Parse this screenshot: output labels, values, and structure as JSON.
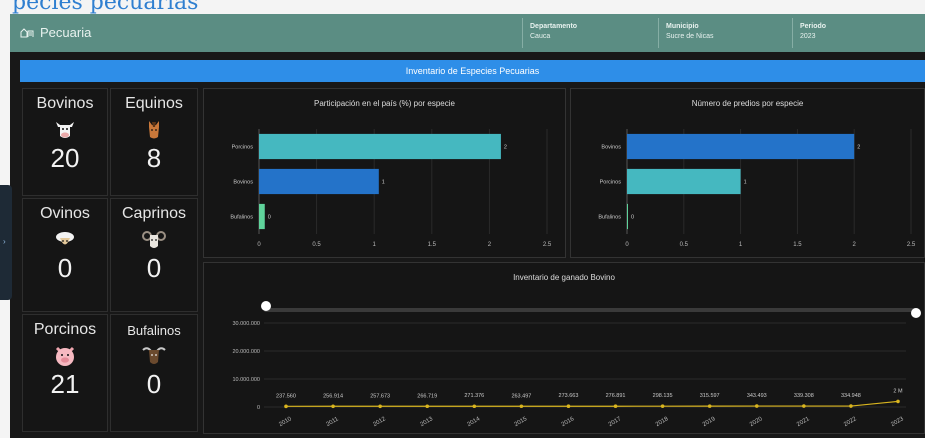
{
  "page_heading": "pecies pecuarias",
  "header": {
    "app_title": "Pecuaria",
    "filters": [
      {
        "label": "Departamento",
        "value": "Cauca"
      },
      {
        "label": "Municipio",
        "value": "Sucre de Nicas"
      },
      {
        "label": "Periodo",
        "value": "2023"
      }
    ]
  },
  "banner": "Inventario de Especies Pecuarias",
  "species": [
    {
      "name": "Bovinos",
      "count": "20",
      "icon": "cow-icon"
    },
    {
      "name": "Equinos",
      "count": "8",
      "icon": "horse-icon"
    },
    {
      "name": "Ovinos",
      "count": "0",
      "icon": "sheep-icon"
    },
    {
      "name": "Caprinos",
      "count": "0",
      "icon": "goat-icon"
    },
    {
      "name": "Porcinos",
      "count": "21",
      "icon": "pig-icon"
    },
    {
      "name": "Bufalinos",
      "count": "0",
      "icon": "buffalo-icon"
    }
  ],
  "colors": {
    "accent_blue": "#2e8ee8",
    "bar_teal": "#45b8c0",
    "bar_blue": "#2473c9",
    "bar_green": "#5fd39b",
    "line_yellow": "#d9b51f"
  },
  "chart_data": [
    {
      "type": "bar",
      "orientation": "horizontal",
      "title": "Participación en el país (%) por especie",
      "categories": [
        "Porcinos",
        "Bovinos",
        "Bufalinos"
      ],
      "values": [
        2.1,
        1.04,
        0.05
      ],
      "data_labels": [
        "2",
        "1",
        "0"
      ],
      "xticks": [
        "0",
        "0.5",
        "1",
        "1.5",
        "2",
        "2.5"
      ],
      "xlim": [
        0,
        2.5
      ]
    },
    {
      "type": "bar",
      "orientation": "horizontal",
      "title": "Número de predios por especie",
      "categories": [
        "Bovinos",
        "Porcinos",
        "Bufalinos"
      ],
      "values": [
        2,
        1,
        0
      ],
      "data_labels": [
        "2",
        "1",
        "0"
      ],
      "xticks": [
        "0",
        "0.5",
        "1",
        "1.5",
        "2",
        "2.5"
      ],
      "xlim": [
        0,
        2.5
      ]
    },
    {
      "type": "line",
      "title": "Inventario de ganado Bovino",
      "x": [
        "2010",
        "2011",
        "2012",
        "2013",
        "2014",
        "2015",
        "2016",
        "2017",
        "2018",
        "2019",
        "2020",
        "2021",
        "2022",
        "2023"
      ],
      "values": [
        237560,
        256914,
        257673,
        266719,
        271376,
        263497,
        273663,
        276891,
        298135,
        315597,
        343493,
        339308,
        334948,
        2000000
      ],
      "data_labels": [
        "237.560",
        "256.914",
        "257.673",
        "266.719",
        "271.376",
        "263.497",
        "273.663",
        "276.891",
        "298.135",
        "315.597",
        "343.493",
        "339.308",
        "334.948",
        "2 M"
      ],
      "yticks": [
        "0",
        "10.000.000",
        "20.000.000",
        "30.000.000"
      ],
      "ylim": [
        0,
        30000000
      ]
    }
  ]
}
